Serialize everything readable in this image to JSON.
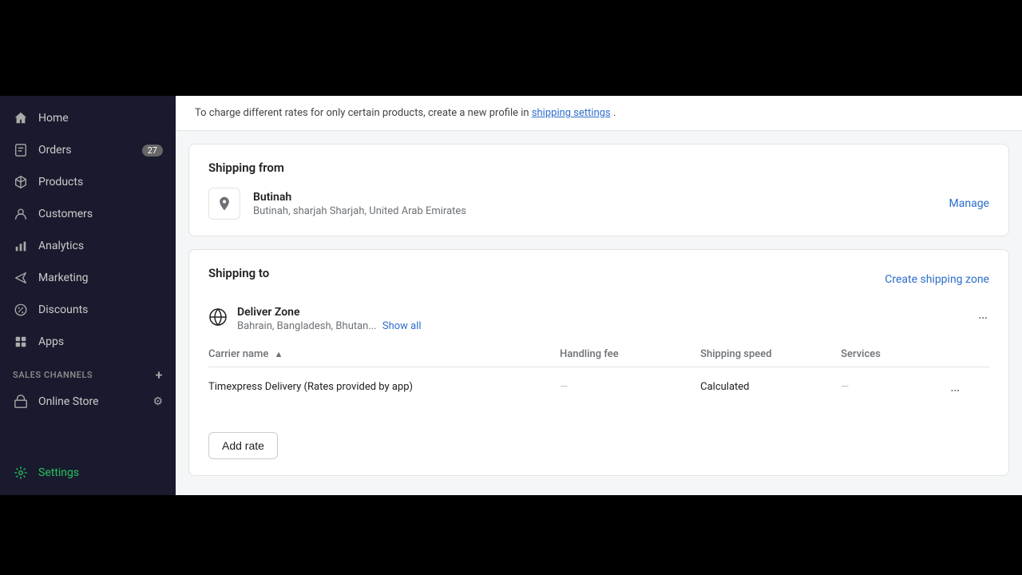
{
  "topBar": {
    "height": 120
  },
  "sidebar": {
    "items": [
      {
        "id": "home",
        "label": "Home",
        "icon": "home-icon",
        "badge": null
      },
      {
        "id": "orders",
        "label": "Orders",
        "icon": "orders-icon",
        "badge": "27"
      },
      {
        "id": "products",
        "label": "Products",
        "icon": "products-icon",
        "badge": null
      },
      {
        "id": "customers",
        "label": "Customers",
        "icon": "customers-icon",
        "badge": null
      },
      {
        "id": "analytics",
        "label": "Analytics",
        "icon": "analytics-icon",
        "badge": null
      },
      {
        "id": "marketing",
        "label": "Marketing",
        "icon": "marketing-icon",
        "badge": null
      },
      {
        "id": "discounts",
        "label": "Discounts",
        "icon": "discounts-icon",
        "badge": null
      },
      {
        "id": "apps",
        "label": "Apps",
        "icon": "apps-icon",
        "badge": null
      }
    ],
    "salesChannelsHeader": "SALES CHANNELS",
    "salesChannelsItems": [
      {
        "id": "online-store",
        "label": "Online Store",
        "icon": "store-icon"
      }
    ],
    "settings": {
      "label": "Settings",
      "icon": "settings-icon"
    }
  },
  "infoBanner": {
    "text": "To charge different rates for only certain products, create a new profile in",
    "linkText": "shipping settings",
    "suffix": "."
  },
  "shippingFrom": {
    "sectionTitle": "Shipping from",
    "locationName": "Butinah",
    "locationAddress": "Butinah, sharjah Sharjah, United Arab Emirates",
    "manageLabel": "Manage"
  },
  "shippingTo": {
    "sectionTitle": "Shipping to",
    "createZoneLabel": "Create shipping zone",
    "zone": {
      "name": "Deliver Zone",
      "countries": "Bahrain, Bangladesh, Bhutan...",
      "showAllLabel": "Show all"
    },
    "table": {
      "columns": [
        {
          "id": "carrier",
          "label": "Carrier name",
          "sortable": true
        },
        {
          "id": "handling",
          "label": "Handling fee"
        },
        {
          "id": "speed",
          "label": "Shipping speed"
        },
        {
          "id": "services",
          "label": "Services"
        },
        {
          "id": "actions",
          "label": ""
        }
      ],
      "rows": [
        {
          "carrier": "Timexpress Delivery (Rates provided by app)",
          "handling": "—",
          "speed": "Calculated",
          "services": "—"
        }
      ]
    },
    "addRateLabel": "Add rate"
  }
}
